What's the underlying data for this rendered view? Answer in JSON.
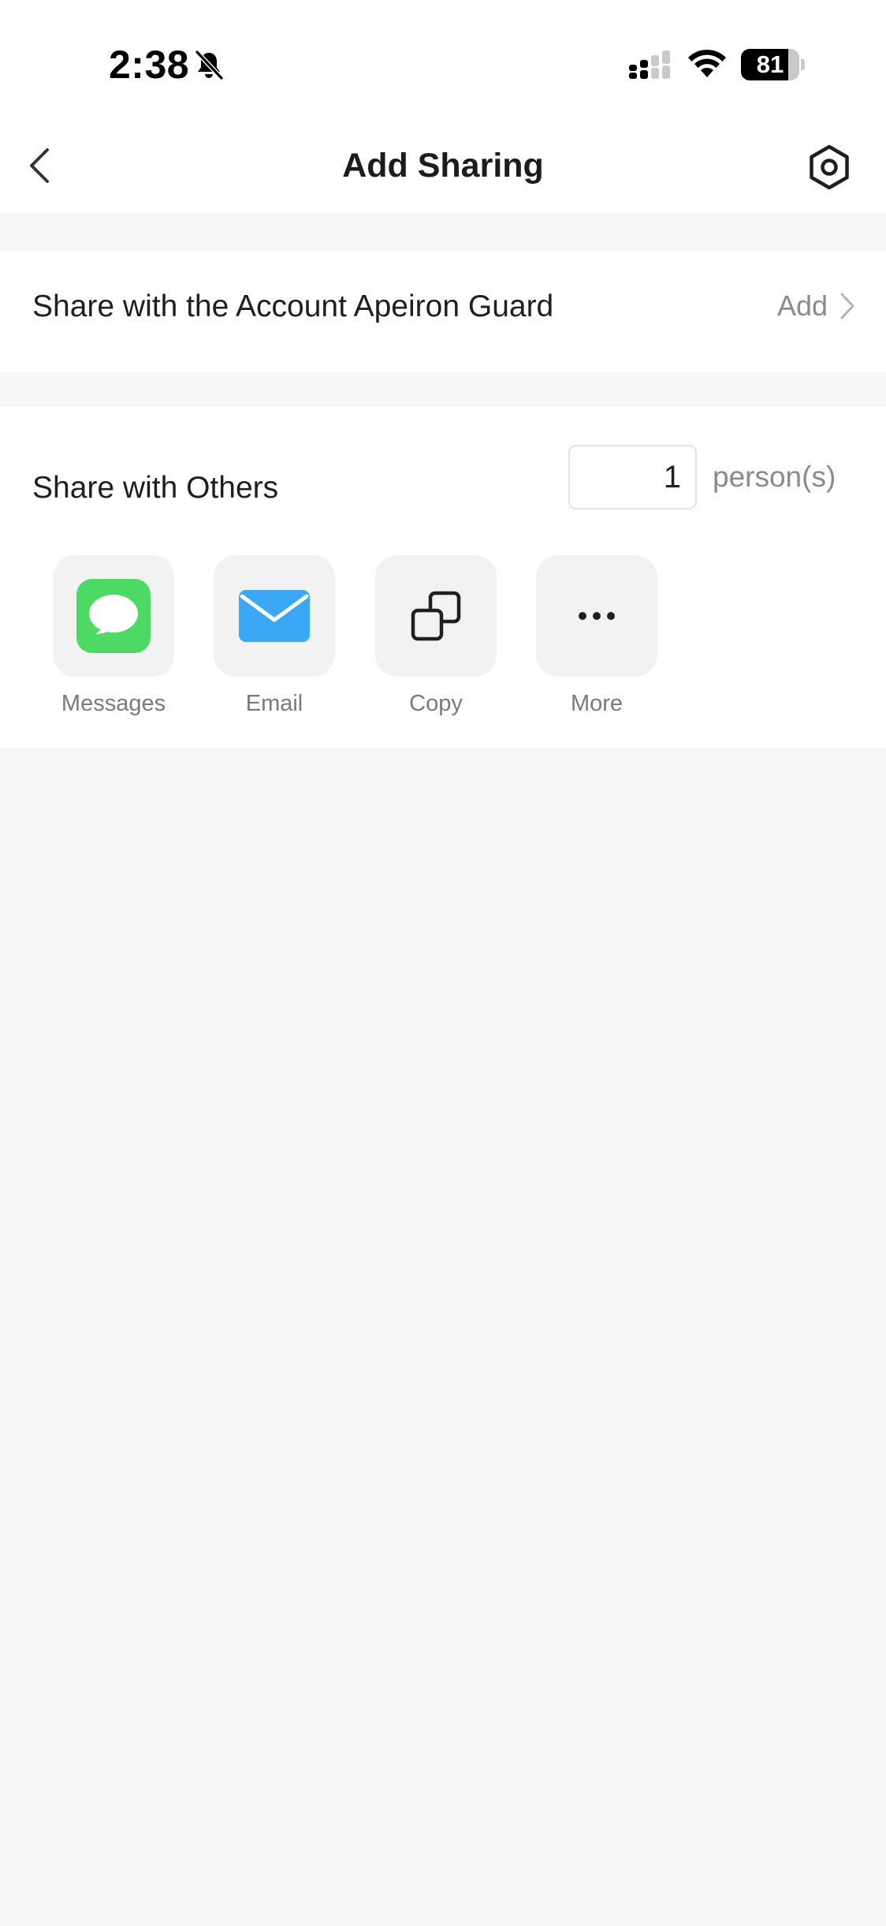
{
  "status_bar": {
    "time": "2:38",
    "battery_level": "81",
    "battery_fraction": 0.81,
    "icons": [
      "bell-slash-icon",
      "signal-icon",
      "wifi-icon",
      "battery-icon"
    ]
  },
  "nav": {
    "title": "Add Sharing",
    "back_icon": "chevron-left-icon",
    "settings_icon": "hexagon-gear-icon"
  },
  "account_share": {
    "label": "Share with the Account Apeiron Guard",
    "action_label": "Add"
  },
  "others_share": {
    "label": "Share with Others",
    "count_value": "1",
    "unit": "person(s)",
    "options": [
      {
        "label": "Messages",
        "icon": "messages-icon",
        "color": "#4cd964"
      },
      {
        "label": "Email",
        "icon": "email-icon",
        "color": "#3aa8f5"
      },
      {
        "label": "Copy",
        "icon": "copy-icon",
        "color": "#1f1f1f"
      },
      {
        "label": "More",
        "icon": "more-icon",
        "color": "#1f1f1f"
      }
    ]
  },
  "colors": {
    "background": "#f7f7f7",
    "card": "#ffffff",
    "muted_text": "#8a8a8a"
  }
}
